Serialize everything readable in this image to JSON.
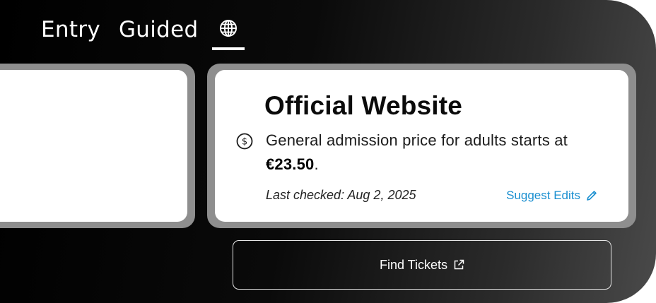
{
  "tabs": [
    {
      "label": "Entry"
    },
    {
      "label": "Guided"
    }
  ],
  "active_tab_icon": "globe-icon",
  "card": {
    "title": "Official Website",
    "icon": "dollar-circle-icon",
    "description_prefix": "General admission price for adults starts at ",
    "price": "€23.50",
    "description_suffix": ".",
    "last_checked": "Last checked: Aug 2, 2025",
    "suggest_edits": "Suggest Edits",
    "suggest_icon": "pencil-icon"
  },
  "find_tickets": {
    "label": "Find Tickets",
    "icon": "external-link-icon"
  },
  "colors": {
    "link": "#1a8fd0",
    "card_border": "#8e8e8e",
    "background_dark": "#000000"
  }
}
